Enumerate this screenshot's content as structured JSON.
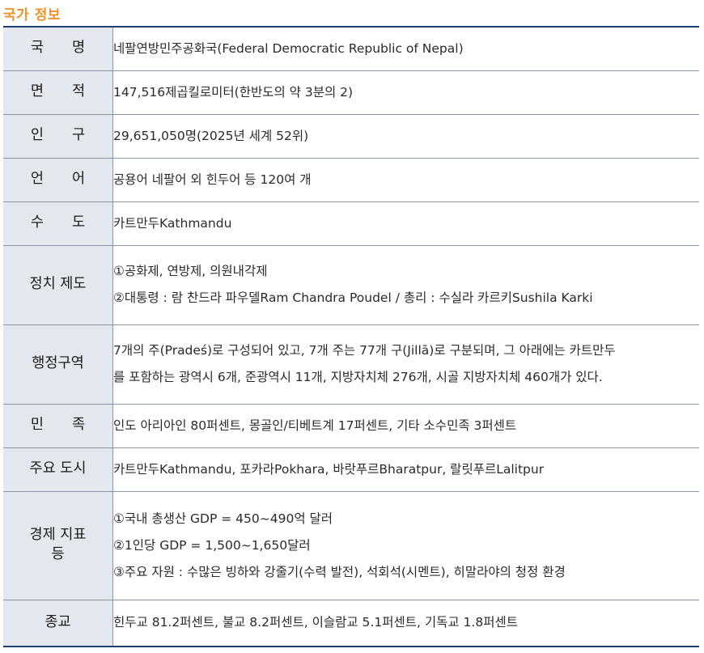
{
  "title": "국가 정보",
  "rows": [
    {
      "label": "국명",
      "lines": [
        "네팔연방민주공화국(Federal Democratic Republic of Nepal)"
      ]
    },
    {
      "label": "면적",
      "lines": [
        "147,516제곱킬로미터(한반도의 약 3분의 2)"
      ]
    },
    {
      "label": "인구",
      "lines": [
        "29,651,050명(2025년 세계 52위)"
      ]
    },
    {
      "label": "언어",
      "lines": [
        "공용어 네팔어 외 힌두어 등 120여 개"
      ]
    },
    {
      "label": "수도",
      "lines": [
        "카트만두Kathmandu"
      ]
    },
    {
      "label": "정치 제도",
      "lines": [
        "①공화제, 연방제, 의원내각제",
        "②대통령 : 람 찬드라 파우델Ram Chandra Poudel / 총리 : 수실라 카르키Sushila Karki"
      ]
    },
    {
      "label": "행정구역",
      "lines": [
        "7개의 주(Pradeś)로 구성되어 있고, 7개 주는 77개 구(Jillā)로 구분되며, 그 아래에는 카트만두",
        "를 포함하는 광역시 6개, 준광역시 11개, 지방자치체 276개, 시골 지방자치체 460개가 있다."
      ]
    },
    {
      "label": "민족",
      "lines": [
        "인도 아리아인 80퍼센트, 몽골인/티베트계 17퍼센트, 기타 소수민족 3퍼센트"
      ]
    },
    {
      "label": "주요 도시",
      "lines": [
        "카트만두Kathmandu, 포카라Pokhara, 바랏푸르Bharatpur, 랄릿푸르Lalitpur"
      ]
    },
    {
      "label": "경제 지표 등",
      "label_lines": [
        "경제 지표",
        "등"
      ],
      "lines": [
        "①국내 총생산 GDP = 450~490억 달러",
        "②1인당 GDP = 1,500~1,650달러",
        "③주요 자원 : 수많은 빙하와 강줄기(수력 발전), 석회석(시멘트), 히말라야의 청정 환경"
      ]
    },
    {
      "label": "종교",
      "lines": [
        "힌두교 81.2퍼센트, 불교 8.2퍼센트, 이슬람교 5.1퍼센트, 기독교 1.8퍼센트"
      ]
    }
  ]
}
